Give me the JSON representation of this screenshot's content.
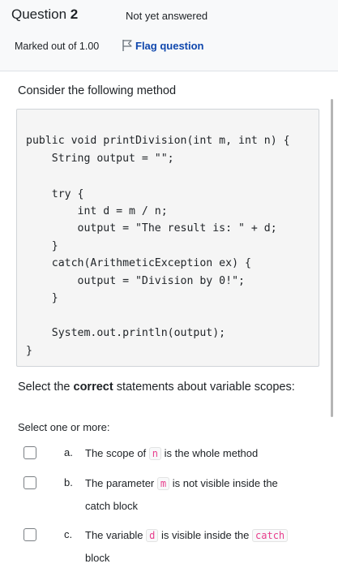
{
  "header": {
    "question_label": "Question",
    "question_number": "2",
    "state": "Not yet answered",
    "grade": "Marked out of 1.00",
    "flag_label": "Flag question"
  },
  "prompt": "Consider the following method",
  "code_lines": [
    "public void printDivision(int m, int n) {",
    "    String output = \"\";",
    "",
    "    try {",
    "        int d = m / n;",
    "        output = \"The result is: \" + d;",
    "    }",
    "    catch(ArithmeticException ex) {",
    "        output = \"Division by 0!\";",
    "    }",
    "",
    "    System.out.println(output);",
    "}"
  ],
  "question_text": {
    "before": "Select the ",
    "bold": "correct",
    "after": " statements about variable scopes:"
  },
  "select_hint": "Select one or more:",
  "options": [
    {
      "letter": "a.",
      "line1_before": "The scope of ",
      "code": "n",
      "line1_after": " is the whole method",
      "line2": ""
    },
    {
      "letter": "b.",
      "line1_before": "The parameter ",
      "code": "m",
      "line1_after": " is not visible inside the",
      "line2": "catch block"
    },
    {
      "letter": "c.",
      "line1_before": "The variable ",
      "code": "d",
      "line1_after": " is visible inside the ",
      "code2": "catch",
      "line2": "block"
    }
  ]
}
